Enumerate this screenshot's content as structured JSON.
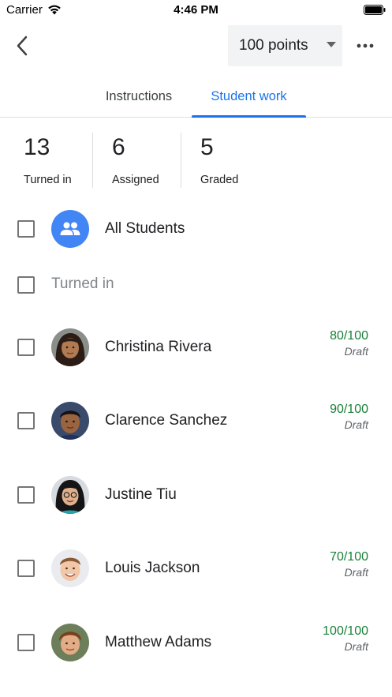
{
  "status_bar": {
    "carrier": "Carrier",
    "time": "4:46 PM"
  },
  "toolbar": {
    "points": "100 points"
  },
  "tabs": [
    {
      "label": "Instructions",
      "selected": false
    },
    {
      "label": "Student work",
      "selected": true
    }
  ],
  "stats": [
    {
      "value": "13",
      "label": "Turned in"
    },
    {
      "value": "6",
      "label": "Assigned"
    },
    {
      "value": "5",
      "label": "Graded"
    }
  ],
  "all_students": {
    "label": "All Students",
    "icon": "group-icon"
  },
  "section": {
    "label": "Turned in"
  },
  "students": [
    {
      "name": "Christina Rivera",
      "grade": "80/100",
      "status": "Draft",
      "avatar": "avatar-christina"
    },
    {
      "name": "Clarence Sanchez",
      "grade": "90/100",
      "status": "Draft",
      "avatar": "avatar-clarence"
    },
    {
      "name": "Justine Tiu",
      "grade": "",
      "status": "",
      "avatar": "avatar-justine"
    },
    {
      "name": "Louis Jackson",
      "grade": "70/100",
      "status": "Draft",
      "avatar": "avatar-louis"
    },
    {
      "name": "Matthew Adams",
      "grade": "100/100",
      "status": "Draft",
      "avatar": "avatar-matthew"
    }
  ],
  "colors": {
    "accent": "#1a73e8",
    "grade": "#188038",
    "avatar_group": "#4285f4"
  }
}
